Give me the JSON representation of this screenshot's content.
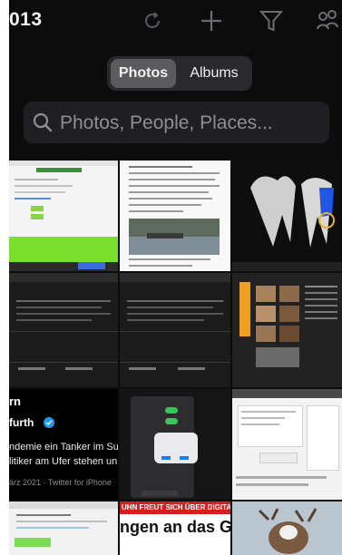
{
  "topbar": {
    "year_fragment": "013"
  },
  "segmented": {
    "photos_label": "Photos",
    "albums_label": "Albums"
  },
  "search": {
    "placeholder": "Photos, People, Places..."
  },
  "thumbs": {
    "tweet": {
      "name_top": "rn",
      "handle": "furth",
      "line1": "ndemie ein Tanker im Sue",
      "line2": "litiker am Ufer stehen un",
      "meta": "ärz 2021 · Twitter for iPhone"
    },
    "headline": {
      "banner": "UHN FREUT SICH ÜBER DIGITALEN FOR",
      "big": "ngen an das Gesun"
    }
  },
  "colors": {
    "background": "#0c0c0d",
    "segment_active": "#5b5b5f",
    "search_field": "#1f1f21",
    "placeholder": "#8e8e93",
    "green": "#34c759"
  }
}
